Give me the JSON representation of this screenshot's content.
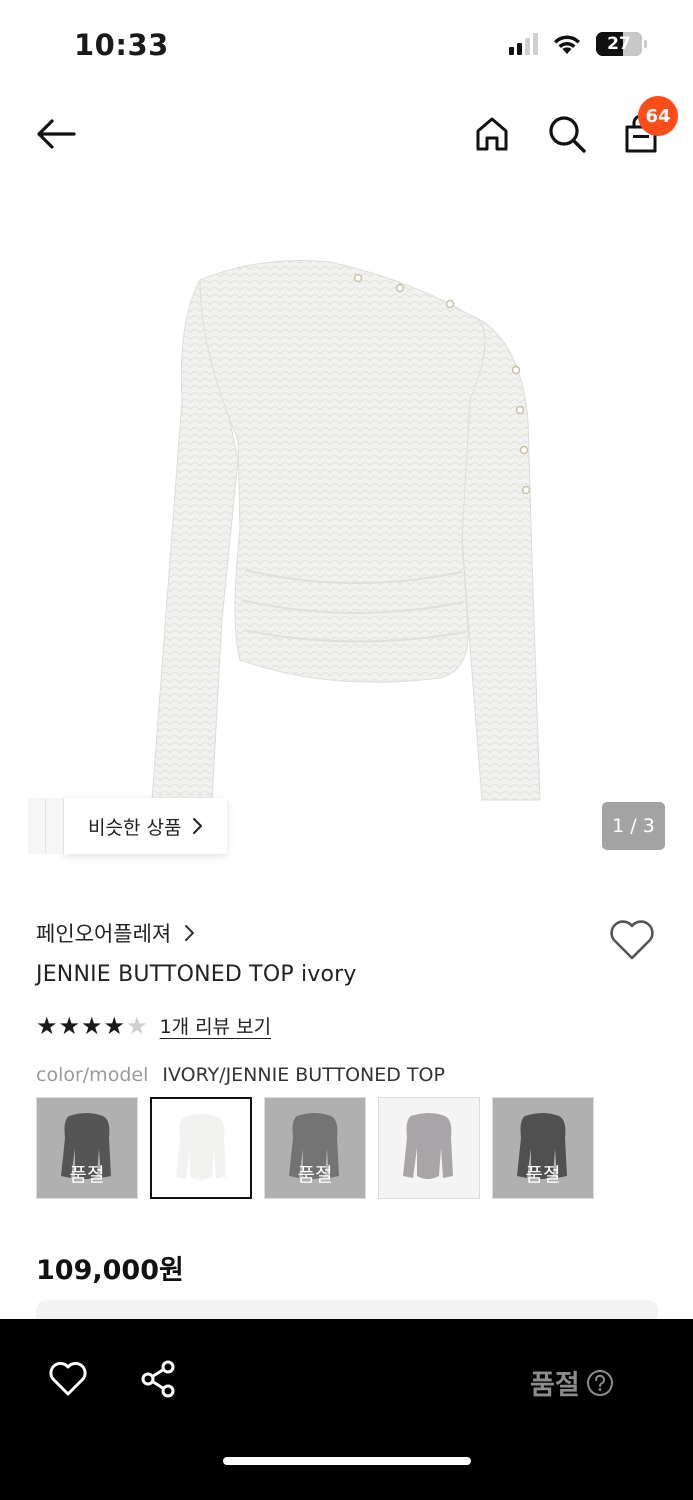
{
  "status_bar": {
    "time": "10:33",
    "battery": "27",
    "icons": [
      "signal-icon",
      "wifi-icon",
      "battery-icon"
    ]
  },
  "header": {
    "icons": [
      "back-arrow-icon",
      "home-icon",
      "search-icon",
      "shopping-bag-icon"
    ],
    "cart_count": "64"
  },
  "gallery": {
    "similar_label": "비슷한 상품",
    "counter": "1 / 3"
  },
  "product": {
    "brand": "페인오어플레져",
    "name": "JENNIE BUTTONED TOP ivory",
    "rating_stars": 4,
    "rating_max": 5,
    "review_link": "1개 리뷰 보기",
    "color_key": "color/model",
    "color_value": "IVORY/JENNIE BUTTONED TOP",
    "price": "109,000원"
  },
  "swatches": [
    {
      "color": "#2b2b2b",
      "sold_out": true,
      "label": "품절"
    },
    {
      "color": "#f2f2f0",
      "sold_out": false,
      "label": ""
    },
    {
      "color": "#6d6d6d",
      "sold_out": true,
      "label": "품절"
    },
    {
      "color": "#a9a4a8",
      "sold_out": false,
      "label": ""
    },
    {
      "color": "#1f1f1f",
      "sold_out": true,
      "label": "품절"
    }
  ],
  "bottom_bar": {
    "soldout_label": "품절",
    "icons": [
      "heart-icon",
      "share-icon",
      "help-icon"
    ]
  },
  "colors": {
    "badge": "#ff4d1a",
    "bottom_bar": "#000000",
    "counter_bg": "#a3a3a3"
  }
}
